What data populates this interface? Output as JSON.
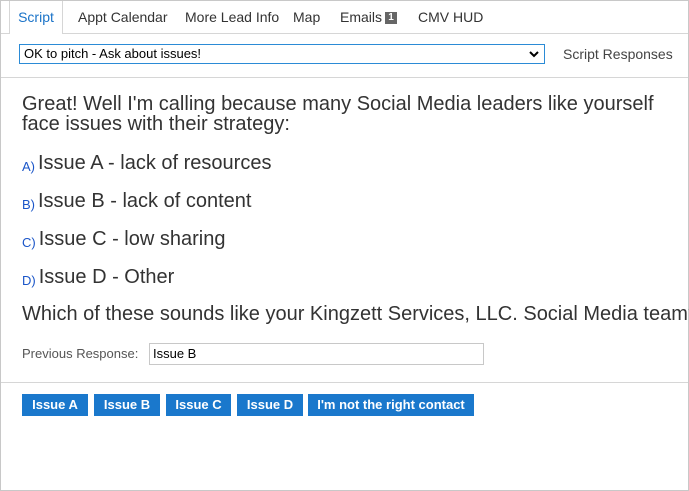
{
  "tabs": [
    {
      "label": "Script"
    },
    {
      "label": "Appt Calendar"
    },
    {
      "label": "More Lead Info"
    },
    {
      "label": "Map"
    },
    {
      "label": "Emails",
      "badge": "1"
    },
    {
      "label": "CMV HUD"
    }
  ],
  "script_select": {
    "value": "OK to pitch - Ask about issues!"
  },
  "script_responses_label": "Script Responses",
  "script": {
    "intro": "Great! Well I'm calling because many Social Media leaders like yourself face issues with their strategy:",
    "options": [
      {
        "key": "A)",
        "text": "Issue A - lack of resources"
      },
      {
        "key": "B)",
        "text": "Issue B - lack of content"
      },
      {
        "key": "C)",
        "text": "Issue C - low sharing"
      },
      {
        "key": "D)",
        "text": "Issue D - Other"
      }
    ],
    "question": "Which of these sounds like your Kingzett Services, LLC. Social Media team?"
  },
  "previous_response": {
    "label": "Previous Response:",
    "value": "Issue B"
  },
  "buttons": [
    {
      "label": "Issue A"
    },
    {
      "label": "Issue B"
    },
    {
      "label": "Issue C"
    },
    {
      "label": "Issue D"
    },
    {
      "label": "I'm not the right contact"
    }
  ],
  "colors": {
    "accent": "#1a78cc",
    "active_tab": "#1a73c8",
    "option_key": "#1a55c8"
  }
}
